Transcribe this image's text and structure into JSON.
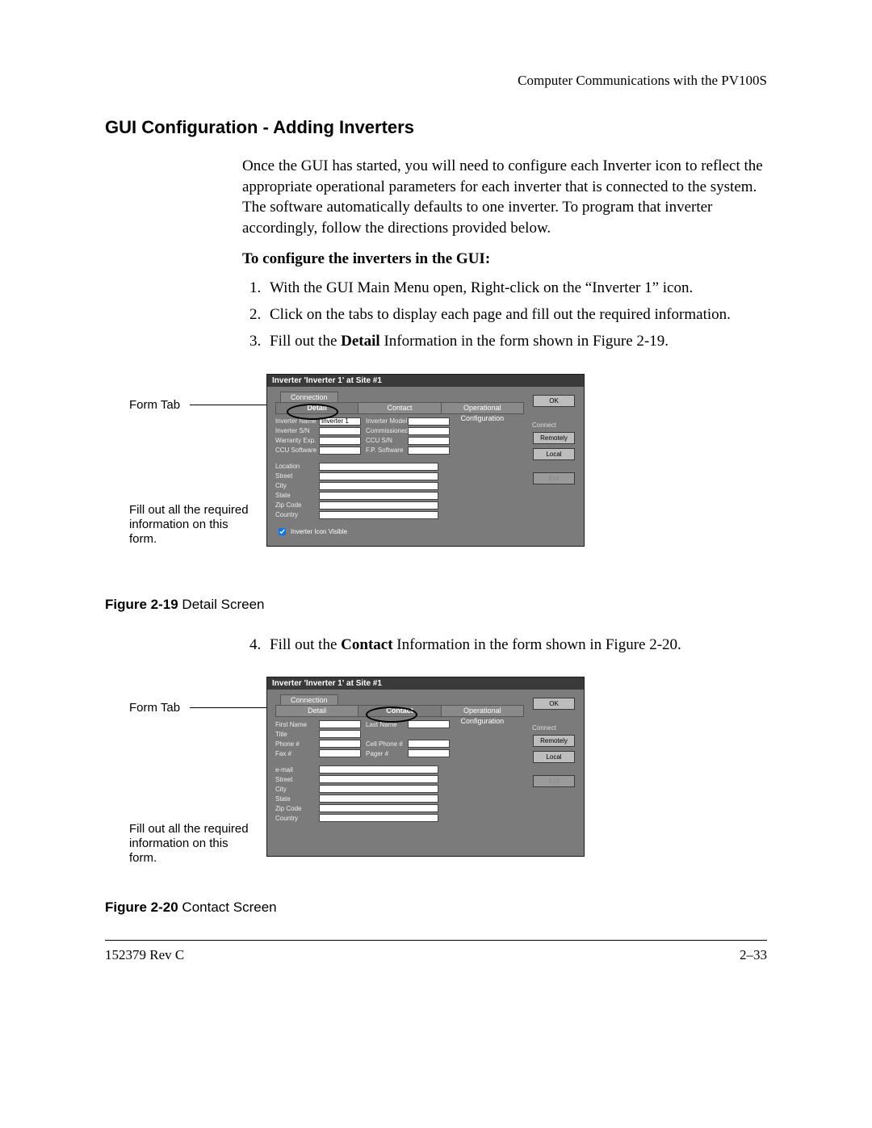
{
  "header": {
    "chapter": "Computer Communications with the PV100S"
  },
  "section": {
    "title": "GUI Configuration - Adding Inverters"
  },
  "intro": "Once the GUI has started, you will need to configure each Inverter icon to reflect the appropriate operational parameters for each inverter that is connected to the system. The software automatically defaults to one inverter. To program that inverter accordingly, follow the directions provided below.",
  "steps_heading": "To configure the inverters in the GUI:",
  "steps": {
    "s1": "With the GUI Main Menu open, Right-click on the “Inverter 1” icon.",
    "s2": "Click on the tabs to display each page and fill out the required information.",
    "s3_a": "Fill out the ",
    "s3_b": "Detail",
    "s3_c": " Information in the form shown in Figure 2-19.",
    "s4_a": "Fill out the ",
    "s4_b": "Contact",
    "s4_c": " Information in the form shown in Figure 2-20."
  },
  "callouts": {
    "form_tab": "Form Tab",
    "fill_out": "Fill out all the required information on this form."
  },
  "dialog_common": {
    "title": "Inverter 'Inverter 1' at Site #1",
    "tab_connection": "Connection",
    "tab_detail": "Detail",
    "tab_contact": "Contact",
    "tab_opconf": "Operational Configuration",
    "btn_ok": "OK",
    "side_label": "Connect",
    "btn_remotely": "Remotely",
    "btn_local": "Local",
    "btn_exit": "Exit"
  },
  "detail_form": {
    "inverter_name_lbl": "Inverter Name",
    "inverter_name_val": "Inverter 1",
    "inverter_model_lbl": "Inverter Model",
    "inverter_sn_lbl": "Inverter S/N",
    "commissioned_lbl": "Commissioned",
    "warranty_lbl": "Warranty Exp.",
    "ccu_sn_lbl": "CCU S/N",
    "ccu_sw_lbl": "CCU Software",
    "fp_sw_lbl": "F.P. Software",
    "location_lbl": "Location",
    "street_lbl": "Street",
    "city_lbl": "City",
    "state_lbl": "State",
    "zip_lbl": "Zip Code",
    "country_lbl": "Country",
    "visible_chk": "Inverter Icon Visible"
  },
  "contact_form": {
    "first_name_lbl": "First Name",
    "last_name_lbl": "Last Name",
    "title_lbl": "Title",
    "phone_lbl": "Phone #",
    "cell_lbl": "Cell Phone #",
    "fax_lbl": "Fax #",
    "pager_lbl": "Pager #",
    "email_lbl": "e-mail",
    "street_lbl": "Street",
    "city_lbl": "City",
    "state_lbl": "State",
    "zip_lbl": "Zip Code",
    "country_lbl": "Country"
  },
  "captions": {
    "c19_b": "Figure 2-19",
    "c19_t": " Detail Screen",
    "c20_b": "Figure 2-20",
    "c20_t": " Contact Screen"
  },
  "footer": {
    "left": "152379 Rev C",
    "right": "2–33"
  }
}
